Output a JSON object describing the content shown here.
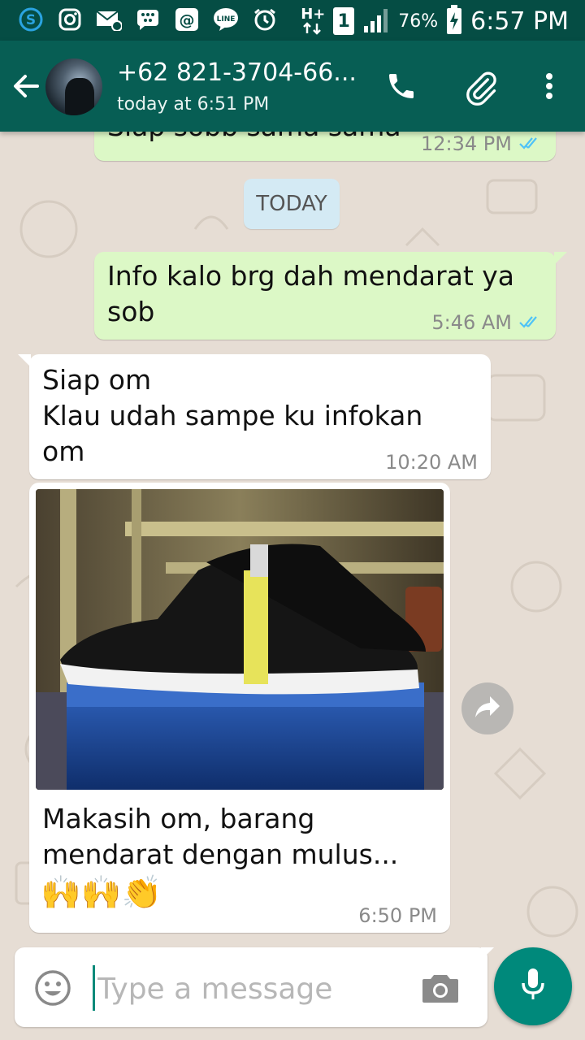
{
  "status_bar": {
    "battery": "76%",
    "time": "6:57 PM",
    "sim_slot": "1",
    "network": "H+",
    "icons": [
      "skype-icon",
      "instagram-icon",
      "email-icon",
      "blackberry-icon",
      "at-icon",
      "line-icon",
      "alarm-icon",
      "network-icon",
      "sim-icon",
      "signal-icon",
      "battery-icon"
    ]
  },
  "header": {
    "contact_name": "+62 821-3704-66...",
    "last_seen": "today at 6:51 PM",
    "icons": [
      "back-arrow-icon",
      "call-icon",
      "attach-icon",
      "more-vert-icon"
    ]
  },
  "chat": {
    "date_divider": "TODAY",
    "messages": [
      {
        "direction": "out",
        "text": "Siap sobb sama sama",
        "time": "12:34 PM",
        "status": "read"
      },
      {
        "direction": "out",
        "text": "Info kalo brg dah mendarat ya\nsob",
        "time": "5:46 AM",
        "status": "read"
      },
      {
        "direction": "in",
        "text": "Siap om\nKlau udah sampe ku infokan\nom",
        "time": "10:20 AM"
      },
      {
        "direction": "in",
        "type": "image",
        "caption": "Makasih om, barang\nmendarat dengan mulus...",
        "emoji": "🙌🙌👏",
        "time": "6:50 PM"
      }
    ]
  },
  "composer": {
    "placeholder": "Type a message"
  },
  "colors": {
    "header": "#075e54",
    "status_bar": "#054d44",
    "outgoing_bubble": "#dcf8c6",
    "incoming_bubble": "#ffffff",
    "accent": "#00897b",
    "read_ticks": "#4fc3f7"
  }
}
